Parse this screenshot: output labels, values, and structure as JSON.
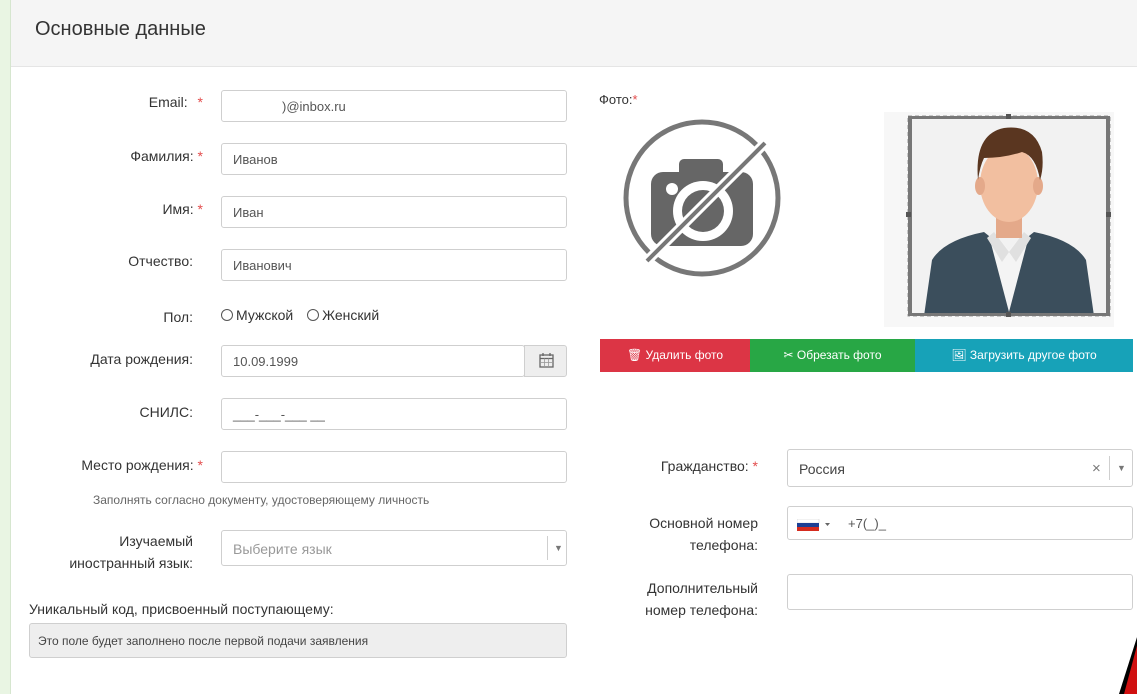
{
  "panel": {
    "title": "Основные данные"
  },
  "form": {
    "email": {
      "label": "Email:",
      "required": "*",
      "value": ")@inbox.ru"
    },
    "lastname": {
      "label": "Фамилия:",
      "required": "*",
      "value": "Иванов"
    },
    "firstname": {
      "label": "Имя:",
      "required": "*",
      "value": "Иван"
    },
    "patronymic": {
      "label": "Отчество:",
      "value": "Иванович"
    },
    "gender": {
      "label": "Пол:",
      "options": [
        "Мужской",
        "Женский"
      ]
    },
    "birthdate": {
      "label": "Дата рождения:",
      "value": "10.09.1999"
    },
    "snils": {
      "label": "СНИЛС:",
      "value": "___-___-___ __"
    },
    "birthplace": {
      "label": "Место рождения:",
      "required": "*",
      "value": "",
      "hint": "Заполнять согласно документу, удостоверяющему личность"
    },
    "language": {
      "label_line1": "Изучаемый",
      "label_line2": "иностранный язык:",
      "placeholder": "Выберите язык"
    },
    "unique_code": {
      "label": "Уникальный код, присвоенный поступающему:",
      "value": "Это поле будет заполнено после первой подачи заявления"
    }
  },
  "photo": {
    "label": "Фото:",
    "required": "*",
    "buttons": {
      "delete": "Удалить фото",
      "crop": "Обрезать фото",
      "upload": "Загрузить другое фото"
    }
  },
  "citizenship": {
    "label": "Гражданство:",
    "required": "*",
    "value": "Россия",
    "clear": "×"
  },
  "phone_main": {
    "label_line1": "Основной номер",
    "label_line2": "телефона:",
    "value": "+7(_)_"
  },
  "phone_extra": {
    "label_line1": "Дополнительный",
    "label_line2": "номер телефона:",
    "value": ""
  },
  "colors": {
    "danger": "#dc3545",
    "success": "#28a745",
    "info": "#17a2b8",
    "required": "#e34b4b"
  }
}
